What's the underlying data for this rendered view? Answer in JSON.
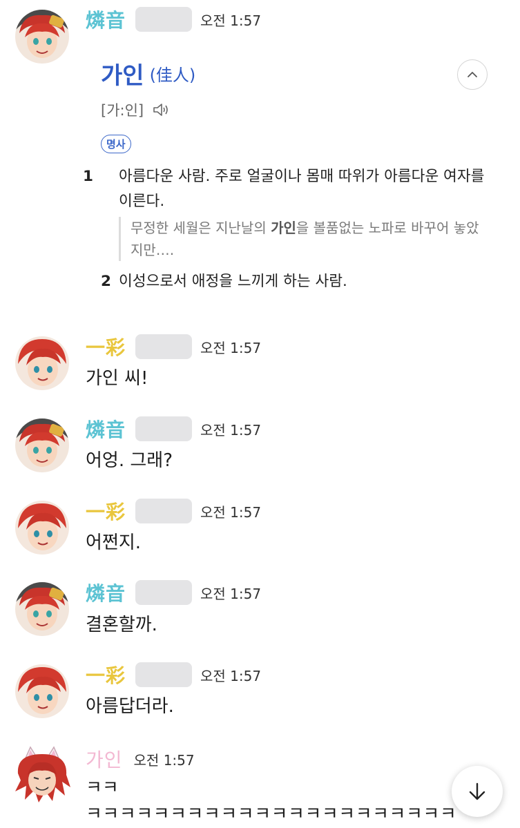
{
  "messages": [
    {
      "name": "燐音",
      "time": "오전 1:57"
    },
    {
      "name": "一彩",
      "time": "오전 1:57",
      "text": "가인 씨!"
    },
    {
      "name": "燐音",
      "time": "오전 1:57",
      "text": "어엉. 그래?"
    },
    {
      "name": "一彩",
      "time": "오전 1:57",
      "text": "어쩐지."
    },
    {
      "name": "燐音",
      "time": "오전 1:57",
      "text": "결혼할까."
    },
    {
      "name": "一彩",
      "time": "오전 1:57",
      "text": "아름답더라."
    },
    {
      "name": "가인",
      "time": "오전 1:57",
      "text": "ㅋㅋ",
      "text2": "ㅋㅋㅋㅋㅋㅋㅋㅋㅋㅋㅋㅋㅋㅋㅋㅋㅋㅋㅋㅋㅋㅋ"
    }
  ],
  "dictionary": {
    "word": "가인",
    "hanja": "(佳人)",
    "pronunciation": "[가:인]",
    "pos": "명사",
    "def1_num": "1",
    "def1_text": "아름다운 사람. 주로 얼굴이나 몸매 따위가 아름다운 여자를 이른다.",
    "example_before": "무정한 세월은 지난날의 ",
    "example_bold": "가인",
    "example_after": "을 볼품없는 노파로 바꾸어 놓았지만….",
    "def2_num": "2",
    "def2_text": "이성으로서 애정을 느끼게 하는 사람."
  },
  "colors": {
    "rinne": "#5cc3d3",
    "ichiko": "#e9c63d",
    "gain": "#f3b8d2",
    "dict_blue": "#2f5bc4"
  },
  "icons": [
    "speaker-icon",
    "chevron-up-icon",
    "arrow-down-icon"
  ]
}
